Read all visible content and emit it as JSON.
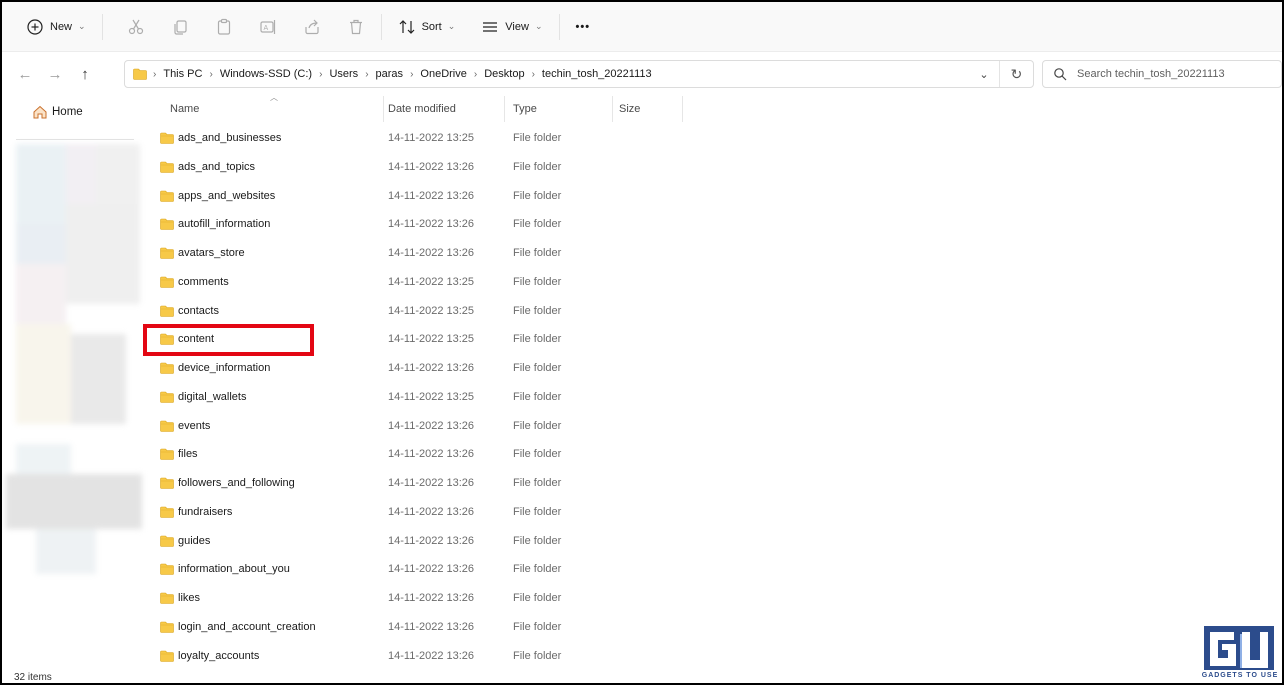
{
  "toolbar": {
    "new_label": "New",
    "sort_label": "Sort",
    "view_label": "View",
    "more_label": "•••",
    "icons": [
      "plus-icon",
      "cut-icon",
      "copy-icon",
      "paste-icon",
      "rename-icon",
      "share-icon",
      "delete-icon",
      "sort-icon",
      "view-icon"
    ]
  },
  "address": {
    "crumbs": [
      "This PC",
      "Windows-SSD (C:)",
      "Users",
      "paras",
      "OneDrive",
      "Desktop",
      "techin_tosh_20221113"
    ],
    "search_placeholder": "Search techin_tosh_20221113"
  },
  "navpane": {
    "home_label": "Home"
  },
  "columns": {
    "name": "Name",
    "date": "Date modified",
    "type": "Type",
    "size": "Size"
  },
  "files": [
    {
      "name": "ads_and_businesses",
      "date": "14-11-2022 13:25",
      "type": "File folder"
    },
    {
      "name": "ads_and_topics",
      "date": "14-11-2022 13:26",
      "type": "File folder"
    },
    {
      "name": "apps_and_websites",
      "date": "14-11-2022 13:26",
      "type": "File folder"
    },
    {
      "name": "autofill_information",
      "date": "14-11-2022 13:26",
      "type": "File folder"
    },
    {
      "name": "avatars_store",
      "date": "14-11-2022 13:26",
      "type": "File folder"
    },
    {
      "name": "comments",
      "date": "14-11-2022 13:25",
      "type": "File folder"
    },
    {
      "name": "contacts",
      "date": "14-11-2022 13:25",
      "type": "File folder"
    },
    {
      "name": "content",
      "date": "14-11-2022 13:25",
      "type": "File folder"
    },
    {
      "name": "device_information",
      "date": "14-11-2022 13:26",
      "type": "File folder"
    },
    {
      "name": "digital_wallets",
      "date": "14-11-2022 13:25",
      "type": "File folder"
    },
    {
      "name": "events",
      "date": "14-11-2022 13:26",
      "type": "File folder"
    },
    {
      "name": "files",
      "date": "14-11-2022 13:26",
      "type": "File folder"
    },
    {
      "name": "followers_and_following",
      "date": "14-11-2022 13:26",
      "type": "File folder"
    },
    {
      "name": "fundraisers",
      "date": "14-11-2022 13:26",
      "type": "File folder"
    },
    {
      "name": "guides",
      "date": "14-11-2022 13:26",
      "type": "File folder"
    },
    {
      "name": "information_about_you",
      "date": "14-11-2022 13:26",
      "type": "File folder"
    },
    {
      "name": "likes",
      "date": "14-11-2022 13:26",
      "type": "File folder"
    },
    {
      "name": "login_and_account_creation",
      "date": "14-11-2022 13:26",
      "type": "File folder"
    },
    {
      "name": "loyalty_accounts",
      "date": "14-11-2022 13:26",
      "type": "File folder"
    }
  ],
  "highlighted_item": "content",
  "status": {
    "item_count": "32 items"
  },
  "watermark": {
    "text": "GADGETS TO USE"
  },
  "colors": {
    "highlight": "#e30613",
    "folder": "#f7c948",
    "logo": "#2c4c8c"
  }
}
